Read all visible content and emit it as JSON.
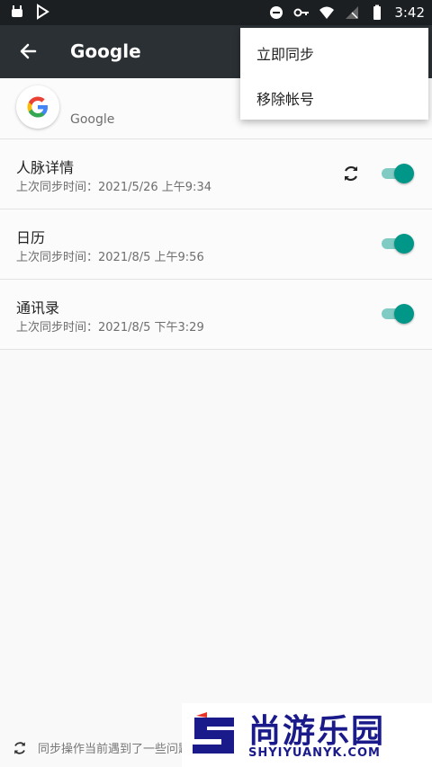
{
  "status_bar": {
    "time": "3:42",
    "icons_left": [
      "android-icon",
      "play-store-icon"
    ],
    "icons_right": [
      "do-not-disturb-icon",
      "vpn-key-icon",
      "wifi-icon",
      "no-signal-icon",
      "battery-icon"
    ]
  },
  "app_bar": {
    "title": "Google",
    "back_icon": "arrow-back-icon"
  },
  "account": {
    "label": "Google",
    "logo_icon": "google-logo-icon"
  },
  "sync_items": [
    {
      "name": "人脉详情",
      "last_sync": "上次同步时间：2021/5/26 上午9:34",
      "enabled": true,
      "syncing": true
    },
    {
      "name": "日历",
      "last_sync": "上次同步时间：2021/8/5 上午9:56",
      "enabled": true,
      "syncing": false
    },
    {
      "name": "通讯录",
      "last_sync": "上次同步时间：2021/8/5 下午3:29",
      "enabled": true,
      "syncing": false
    }
  ],
  "overflow_menu": {
    "items": [
      "立即同步",
      "移除帐号"
    ]
  },
  "footer": {
    "message": "同步操作当前遇到了一些问题",
    "icon": "sync-problem-icon"
  },
  "watermark": {
    "brand_cn": "尚游乐园",
    "brand_en": "SHYIYUANYK.COM"
  },
  "colors": {
    "accent": "#009688",
    "accent_track": "#80cbc4",
    "app_bar": "#2a3034",
    "status_bar": "#1b1f22"
  }
}
